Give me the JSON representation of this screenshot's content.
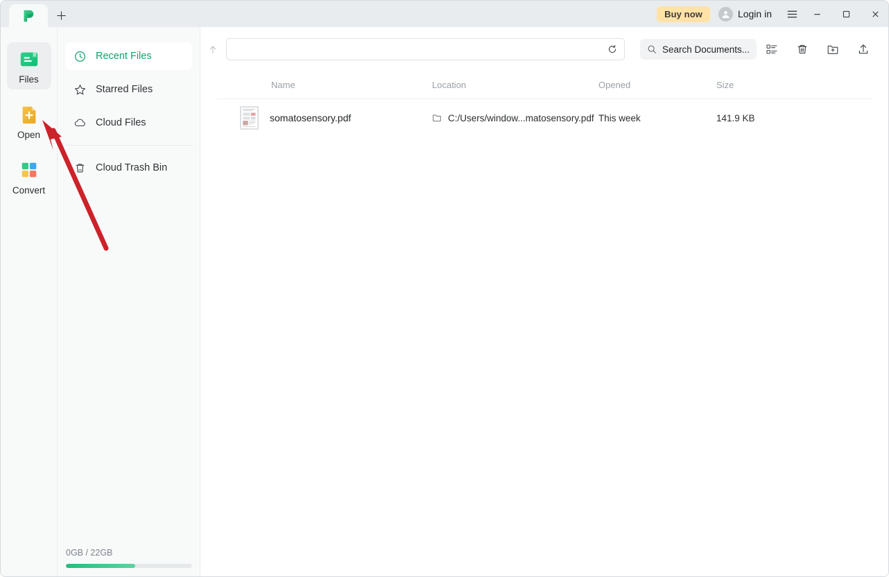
{
  "window": {
    "tab_logo": "app-logo-green-p",
    "new_tab_label": "+",
    "buy_now_label": "Buy now",
    "login_label": "Login in",
    "menu_icon": "hamburger-menu-icon",
    "minimize_icon": "minimize-icon",
    "maximize_icon": "maximize-icon",
    "close_icon": "close-icon"
  },
  "rail": {
    "items": [
      {
        "label": "Files",
        "icon": "files-icon",
        "active": true
      },
      {
        "label": "Open",
        "icon": "open-file-icon",
        "active": false
      },
      {
        "label": "Convert",
        "icon": "convert-icon",
        "active": false
      }
    ]
  },
  "nav": {
    "items": [
      {
        "label": "Recent Files",
        "icon": "clock-icon",
        "active": true
      },
      {
        "label": "Starred Files",
        "icon": "star-icon",
        "active": false
      },
      {
        "label": "Cloud Files",
        "icon": "cloud-icon",
        "active": false
      },
      {
        "label": "Cloud Trash Bin",
        "icon": "trash-icon",
        "active": false
      }
    ],
    "storage": {
      "label": "0GB / 22GB",
      "used_gb": 0,
      "total_gb": 22,
      "fill_percent": 55,
      "fill_color": "#25bd7d"
    }
  },
  "toolbar": {
    "up_icon": "arrow-up-icon",
    "address_value": "",
    "address_placeholder": "",
    "refresh_icon": "refresh-icon",
    "search_placeholder": "Search Documents...",
    "search_icon": "search-icon",
    "view_toggle_icon": "list-view-icon",
    "trash_icon": "trash-bin-icon",
    "new_folder_icon": "new-folder-icon",
    "share_icon": "upload-share-icon"
  },
  "table": {
    "columns": [
      "Name",
      "Location",
      "Opened",
      "Size"
    ],
    "rows": [
      {
        "name": "somatosensory.pdf",
        "location": "C:/Users/window...matosensory.pdf",
        "opened": "This week",
        "size": "141.9 KB",
        "thumb": "pdf-page-thumbnail"
      }
    ]
  },
  "annotation": {
    "arrow_color": "#cc2229",
    "points_to": "Open"
  }
}
